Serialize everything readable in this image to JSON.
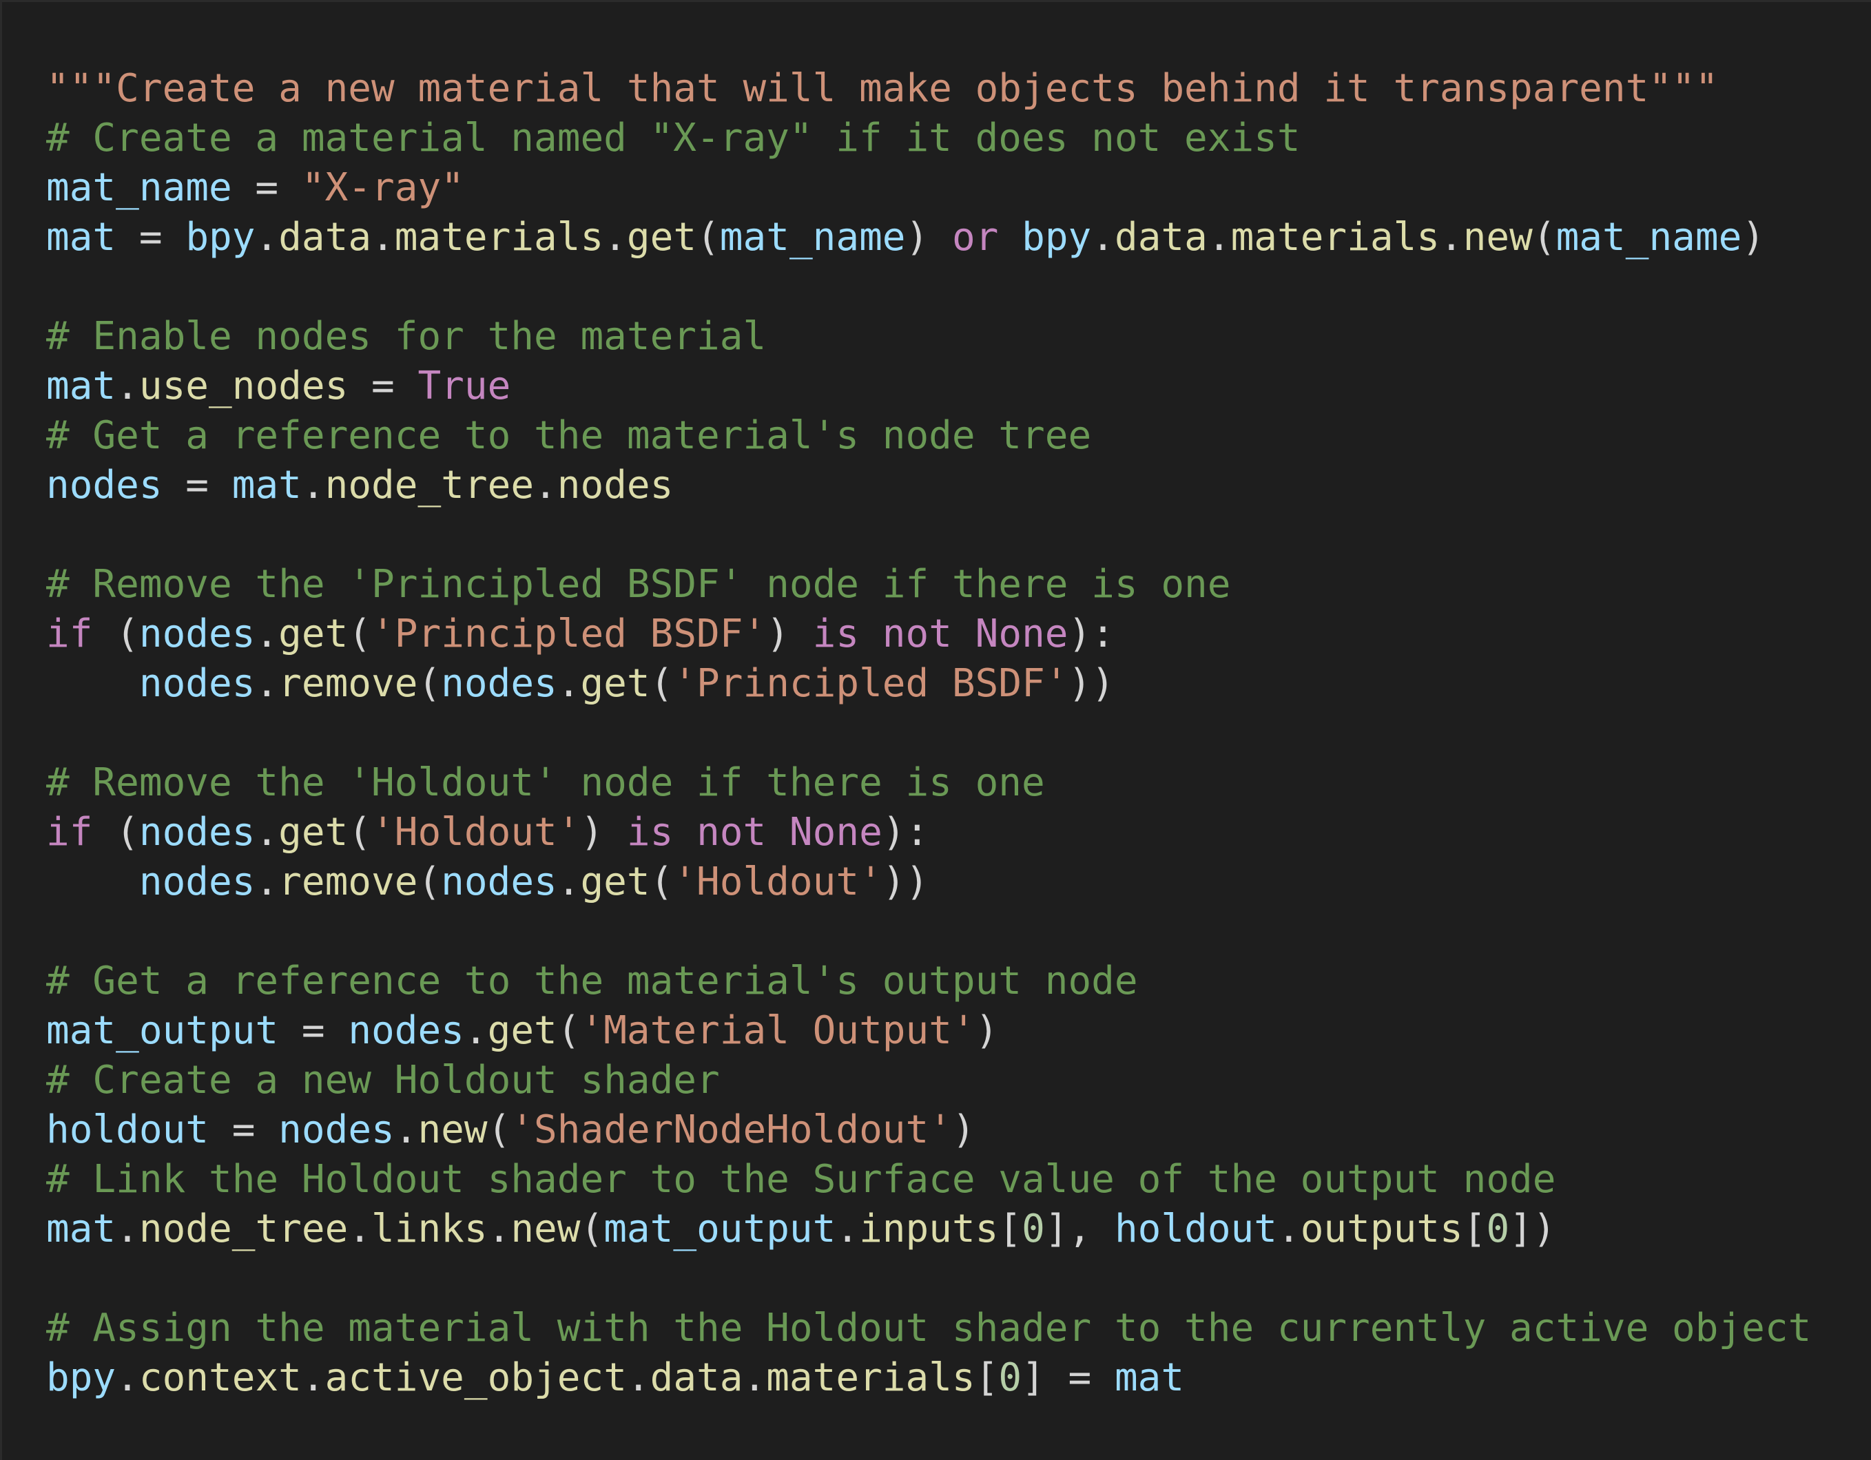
{
  "theme": {
    "background": "#1e1e1e",
    "border": "#2b2b2b",
    "colors": {
      "com": "#6a9955",
      "str": "#ce9178",
      "var": "#9cdcfe",
      "fn": "#dcdcaa",
      "kw": "#c586c0",
      "num": "#b5cea8",
      "op": "#d4d4d4"
    }
  },
  "code": {
    "lines": [
      [
        [
          "str",
          "\"\"\"Create a new material that will make objects behind it transparent\"\"\""
        ]
      ],
      [
        [
          "com",
          "# Create a material named \"X-ray\" if it does not exist"
        ]
      ],
      [
        [
          "var",
          "mat_name"
        ],
        [
          "op",
          " = "
        ],
        [
          "str",
          "\"X-ray\""
        ]
      ],
      [
        [
          "var",
          "mat"
        ],
        [
          "op",
          " = "
        ],
        [
          "var",
          "bpy"
        ],
        [
          "op",
          "."
        ],
        [
          "fn",
          "data"
        ],
        [
          "op",
          "."
        ],
        [
          "fn",
          "materials"
        ],
        [
          "op",
          "."
        ],
        [
          "fn",
          "get"
        ],
        [
          "op",
          "("
        ],
        [
          "var",
          "mat_name"
        ],
        [
          "op",
          ") "
        ],
        [
          "kw",
          "or"
        ],
        [
          "op",
          " "
        ],
        [
          "var",
          "bpy"
        ],
        [
          "op",
          "."
        ],
        [
          "fn",
          "data"
        ],
        [
          "op",
          "."
        ],
        [
          "fn",
          "materials"
        ],
        [
          "op",
          "."
        ],
        [
          "fn",
          "new"
        ],
        [
          "op",
          "("
        ],
        [
          "var",
          "mat_name"
        ],
        [
          "op",
          ")"
        ]
      ],
      [],
      [
        [
          "com",
          "# Enable nodes for the material"
        ]
      ],
      [
        [
          "var",
          "mat"
        ],
        [
          "op",
          "."
        ],
        [
          "fn",
          "use_nodes"
        ],
        [
          "op",
          " = "
        ],
        [
          "kw",
          "True"
        ]
      ],
      [
        [
          "com",
          "# Get a reference to the material's node tree"
        ]
      ],
      [
        [
          "var",
          "nodes"
        ],
        [
          "op",
          " = "
        ],
        [
          "var",
          "mat"
        ],
        [
          "op",
          "."
        ],
        [
          "fn",
          "node_tree"
        ],
        [
          "op",
          "."
        ],
        [
          "fn",
          "nodes"
        ]
      ],
      [],
      [
        [
          "com",
          "# Remove the 'Principled BSDF' node if there is one"
        ]
      ],
      [
        [
          "kw",
          "if"
        ],
        [
          "op",
          " ("
        ],
        [
          "var",
          "nodes"
        ],
        [
          "op",
          "."
        ],
        [
          "fn",
          "get"
        ],
        [
          "op",
          "("
        ],
        [
          "str",
          "'Principled BSDF'"
        ],
        [
          "op",
          ") "
        ],
        [
          "kw",
          "is not None"
        ],
        [
          "op",
          "):"
        ]
      ],
      [
        [
          "op",
          "    "
        ],
        [
          "var",
          "nodes"
        ],
        [
          "op",
          "."
        ],
        [
          "fn",
          "remove"
        ],
        [
          "op",
          "("
        ],
        [
          "var",
          "nodes"
        ],
        [
          "op",
          "."
        ],
        [
          "fn",
          "get"
        ],
        [
          "op",
          "("
        ],
        [
          "str",
          "'Principled BSDF'"
        ],
        [
          "op",
          "))"
        ]
      ],
      [],
      [
        [
          "com",
          "# Remove the 'Holdout' node if there is one"
        ]
      ],
      [
        [
          "kw",
          "if"
        ],
        [
          "op",
          " ("
        ],
        [
          "var",
          "nodes"
        ],
        [
          "op",
          "."
        ],
        [
          "fn",
          "get"
        ],
        [
          "op",
          "("
        ],
        [
          "str",
          "'Holdout'"
        ],
        [
          "op",
          ") "
        ],
        [
          "kw",
          "is not None"
        ],
        [
          "op",
          "):"
        ]
      ],
      [
        [
          "op",
          "    "
        ],
        [
          "var",
          "nodes"
        ],
        [
          "op",
          "."
        ],
        [
          "fn",
          "remove"
        ],
        [
          "op",
          "("
        ],
        [
          "var",
          "nodes"
        ],
        [
          "op",
          "."
        ],
        [
          "fn",
          "get"
        ],
        [
          "op",
          "("
        ],
        [
          "str",
          "'Holdout'"
        ],
        [
          "op",
          "))"
        ]
      ],
      [],
      [
        [
          "com",
          "# Get a reference to the material's output node"
        ]
      ],
      [
        [
          "var",
          "mat_output"
        ],
        [
          "op",
          " = "
        ],
        [
          "var",
          "nodes"
        ],
        [
          "op",
          "."
        ],
        [
          "fn",
          "get"
        ],
        [
          "op",
          "("
        ],
        [
          "str",
          "'Material Output'"
        ],
        [
          "op",
          ")"
        ]
      ],
      [
        [
          "com",
          "# Create a new Holdout shader"
        ]
      ],
      [
        [
          "var",
          "holdout"
        ],
        [
          "op",
          " = "
        ],
        [
          "var",
          "nodes"
        ],
        [
          "op",
          "."
        ],
        [
          "fn",
          "new"
        ],
        [
          "op",
          "("
        ],
        [
          "str",
          "'ShaderNodeHoldout'"
        ],
        [
          "op",
          ")"
        ]
      ],
      [
        [
          "com",
          "# Link the Holdout shader to the Surface value of the output node"
        ]
      ],
      [
        [
          "var",
          "mat"
        ],
        [
          "op",
          "."
        ],
        [
          "fn",
          "node_tree"
        ],
        [
          "op",
          "."
        ],
        [
          "fn",
          "links"
        ],
        [
          "op",
          "."
        ],
        [
          "fn",
          "new"
        ],
        [
          "op",
          "("
        ],
        [
          "var",
          "mat_output"
        ],
        [
          "op",
          "."
        ],
        [
          "fn",
          "inputs"
        ],
        [
          "op",
          "["
        ],
        [
          "num",
          "0"
        ],
        [
          "op",
          "], "
        ],
        [
          "var",
          "holdout"
        ],
        [
          "op",
          "."
        ],
        [
          "fn",
          "outputs"
        ],
        [
          "op",
          "["
        ],
        [
          "num",
          "0"
        ],
        [
          "op",
          "])"
        ]
      ],
      [],
      [
        [
          "com",
          "# Assign the material with the Holdout shader to the currently active object"
        ]
      ],
      [
        [
          "var",
          "bpy"
        ],
        [
          "op",
          "."
        ],
        [
          "fn",
          "context"
        ],
        [
          "op",
          "."
        ],
        [
          "fn",
          "active_object"
        ],
        [
          "op",
          "."
        ],
        [
          "fn",
          "data"
        ],
        [
          "op",
          "."
        ],
        [
          "fn",
          "materials"
        ],
        [
          "op",
          "["
        ],
        [
          "num",
          "0"
        ],
        [
          "op",
          "] = "
        ],
        [
          "var",
          "mat"
        ]
      ]
    ]
  }
}
